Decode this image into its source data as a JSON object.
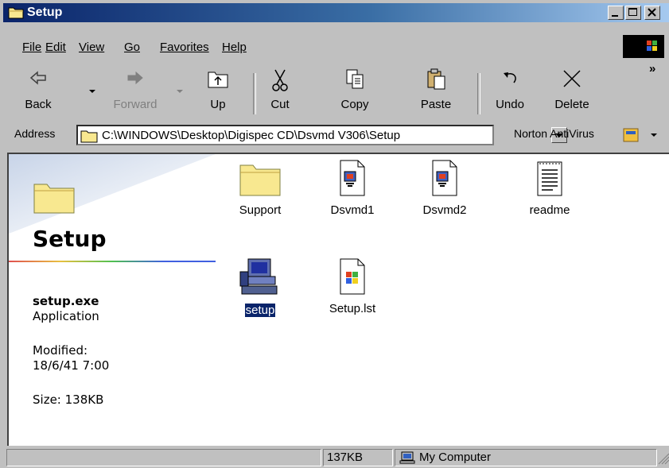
{
  "window": {
    "title": "Setup"
  },
  "menu": [
    "File",
    "Edit",
    "View",
    "Go",
    "Favorites",
    "Help"
  ],
  "toolbar": {
    "back": "Back",
    "forward": "Forward",
    "up": "Up",
    "cut": "Cut",
    "copy": "Copy",
    "paste": "Paste",
    "undo": "Undo",
    "delete": "Delete",
    "more": "»"
  },
  "address": {
    "label": "Address",
    "value": "C:\\WINDOWS\\Desktop\\Digispec CD\\Dsvmd V306\\Setup",
    "norton": "Norton AntiVirus"
  },
  "info_pane": {
    "title": "Setup",
    "file_name": "setup.exe",
    "file_type": "Application",
    "modified_label": "Modified:",
    "modified_value": "18/6/41 7:00",
    "size": "Size: 138KB"
  },
  "files": [
    {
      "name": "Support",
      "icon": "folder-icon"
    },
    {
      "name": "Dsvmd1",
      "icon": "document-icon"
    },
    {
      "name": "Dsvmd2",
      "icon": "document-icon"
    },
    {
      "name": "readme",
      "icon": "text-file-icon"
    },
    {
      "name": "setup",
      "icon": "setup-computer-icon",
      "selected": true
    },
    {
      "name": "Setup.lst",
      "icon": "windows-file-icon"
    }
  ],
  "status": {
    "size": "137KB",
    "zone": "My Computer"
  },
  "colors": {
    "title_active": "#0a246a",
    "selection": "#0a246a",
    "chrome": "#c0c0c0"
  }
}
